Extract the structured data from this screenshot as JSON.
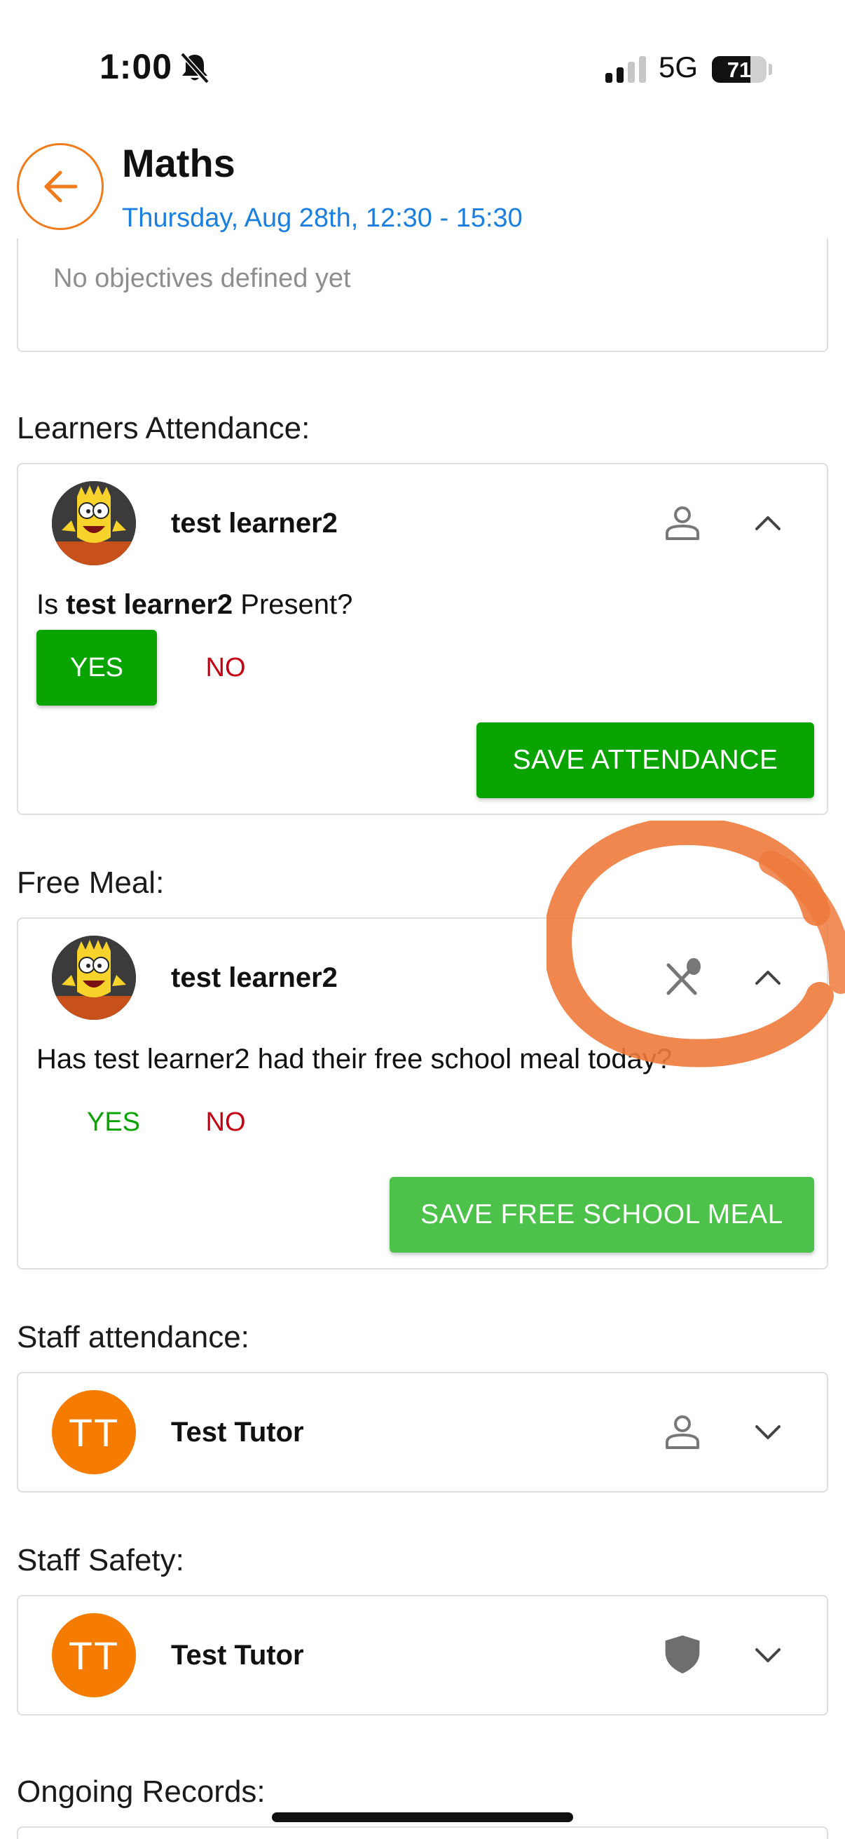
{
  "status_bar": {
    "time": "1:00",
    "network": "5G",
    "battery_percent": "71",
    "battery_level": 0.71,
    "silent_icon": "bell-slash-icon"
  },
  "header": {
    "title": "Maths",
    "subtitle": "Thursday, Aug 28th, 12:30 - 15:30",
    "back_icon": "arrow-left-icon",
    "accent_color": "#f07c1b",
    "subtitle_color": "#1b7fe0"
  },
  "objectives": {
    "text": "No objectives defined yet"
  },
  "learners_attendance": {
    "label": "Learners Attendance:",
    "learner_name": "test learner2",
    "question_prefix": "Is ",
    "question_name": "test learner2",
    "question_suffix": " Present?",
    "yes_label": "YES",
    "no_label": "NO",
    "selected": "YES",
    "save_label": "SAVE ATTENDANCE",
    "status_icon": "person-icon"
  },
  "free_meal": {
    "label": "Free Meal:",
    "learner_name": "test learner2",
    "question": "Has test learner2 had their free school meal today?",
    "yes_label": "YES",
    "no_label": "NO",
    "save_label": "SAVE FREE SCHOOL MEAL",
    "status_icon": "no-meal-icon"
  },
  "staff_attendance": {
    "label": "Staff attendance:",
    "initials": "TT",
    "name": "Test Tutor",
    "status_icon": "person-icon"
  },
  "staff_safety": {
    "label": "Staff Safety:",
    "initials": "TT",
    "name": "Test Tutor",
    "status_icon": "shield-icon"
  },
  "ongoing_records": {
    "label": "Ongoing Records:"
  },
  "colors": {
    "green": "#0aa400",
    "light_green": "#4cc24a",
    "red": "#c40012",
    "orange": "#f57c00",
    "annotation": "#ee7a3c"
  }
}
